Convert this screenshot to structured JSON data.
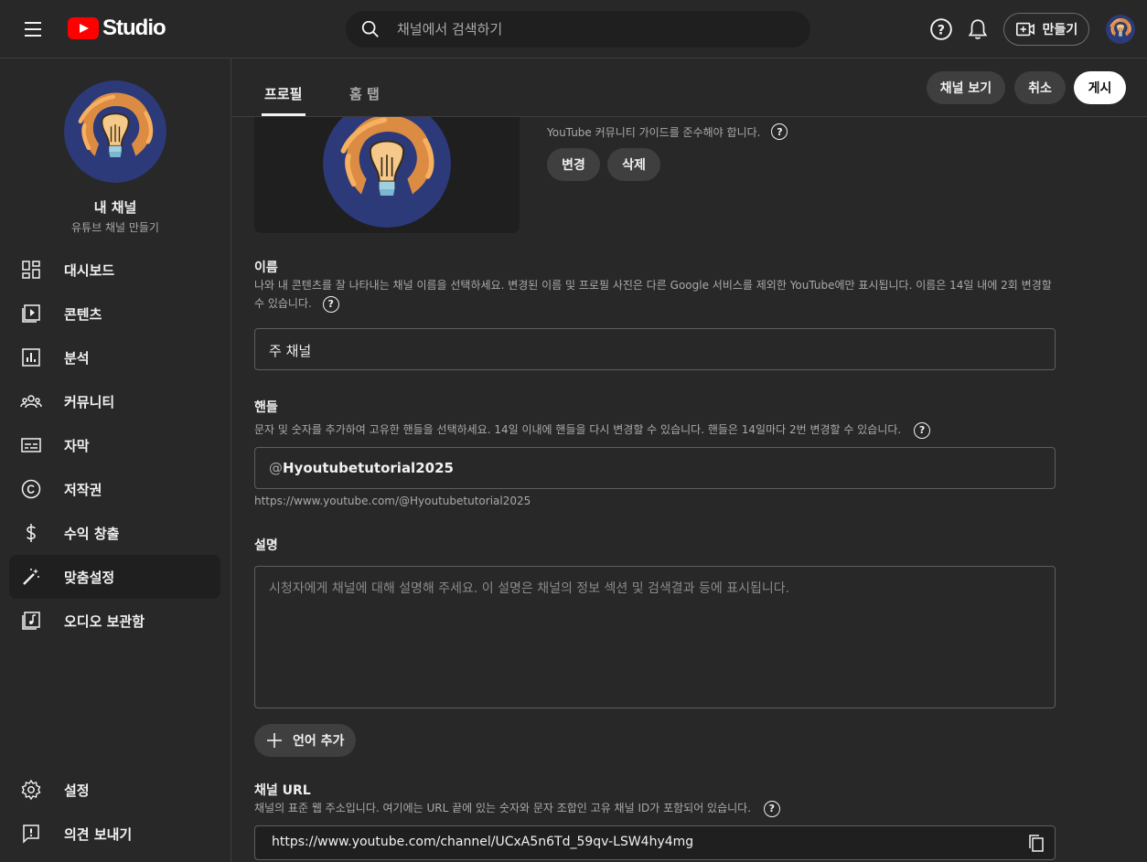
{
  "header": {
    "logo_text": "Studio",
    "search_placeholder": "채널에서 검색하기",
    "create_label": "만들기"
  },
  "sidebar": {
    "channel_name": "내 채널",
    "channel_sub": "유튜브 채널 만들기",
    "items": [
      {
        "label": "대시보드",
        "icon": "dashboard-icon"
      },
      {
        "label": "콘텐츠",
        "icon": "content-icon"
      },
      {
        "label": "분석",
        "icon": "analytics-icon"
      },
      {
        "label": "커뮤니티",
        "icon": "community-icon"
      },
      {
        "label": "자막",
        "icon": "subtitles-icon"
      },
      {
        "label": "저작권",
        "icon": "copyright-icon"
      },
      {
        "label": "수익 창출",
        "icon": "monetization-icon"
      },
      {
        "label": "맞춤설정",
        "icon": "customization-icon"
      },
      {
        "label": "오디오 보관함",
        "icon": "audio-library-icon"
      }
    ],
    "bottom_items": [
      {
        "label": "설정",
        "icon": "settings-icon"
      },
      {
        "label": "의견 보내기",
        "icon": "feedback-icon"
      }
    ]
  },
  "tabs": [
    {
      "label": "프로필",
      "active": true
    },
    {
      "label": "홈 탭",
      "active": false
    }
  ],
  "actions": {
    "view_channel": "채널 보기",
    "cancel": "취소",
    "publish": "게시"
  },
  "profile_photo": {
    "guideline_text": "YouTube 커뮤니티 가이드를 준수해야 합니다.",
    "change_label": "변경",
    "delete_label": "삭제"
  },
  "name_section": {
    "title": "이름",
    "description": "나와 내 콘텐츠를 잘 나타내는 채널 이름을 선택하세요. 변경된 이름 및 프로필 사진은 다른 Google 서비스를 제외한 YouTube에만 표시됩니다. 이름은 14일 내에 2회 변경할 수 있습니다.",
    "value": "주 채널"
  },
  "handle_section": {
    "title": "핸들",
    "description": "문자 및 숫자를 추가하여 고유한 핸들을 선택하세요. 14일 이내에 핸들을 다시 변경할 수 있습니다. 핸들은 14일마다 2번 변경할 수 있습니다.",
    "prefix": "@",
    "value": "Hyoutubetutorial2025",
    "url": "https://www.youtube.com/@Hyoutubetutorial2025"
  },
  "description_section": {
    "title": "설명",
    "placeholder": "시청자에게 채널에 대해 설명해 주세요. 이 설명은 채널의 정보 섹션 및 검색결과 등에 표시됩니다.",
    "add_language": "언어 추가"
  },
  "url_section": {
    "title": "채널 URL",
    "description": "채널의 표준 웹 주소입니다. 여기에는 URL 끝에 있는 숫자와 문자 조합인 고유 채널 ID가 포함되어 있습니다.",
    "value": "https://www.youtube.com/channel/UCxA5n6Td_59qv-LSW4hy4mg"
  },
  "colors": {
    "background": "#282828",
    "surface": "#1f1f1f",
    "brand_red": "#ff0000",
    "avatar_bg": "#2d3a7a",
    "avatar_accent": "#f0963c"
  }
}
